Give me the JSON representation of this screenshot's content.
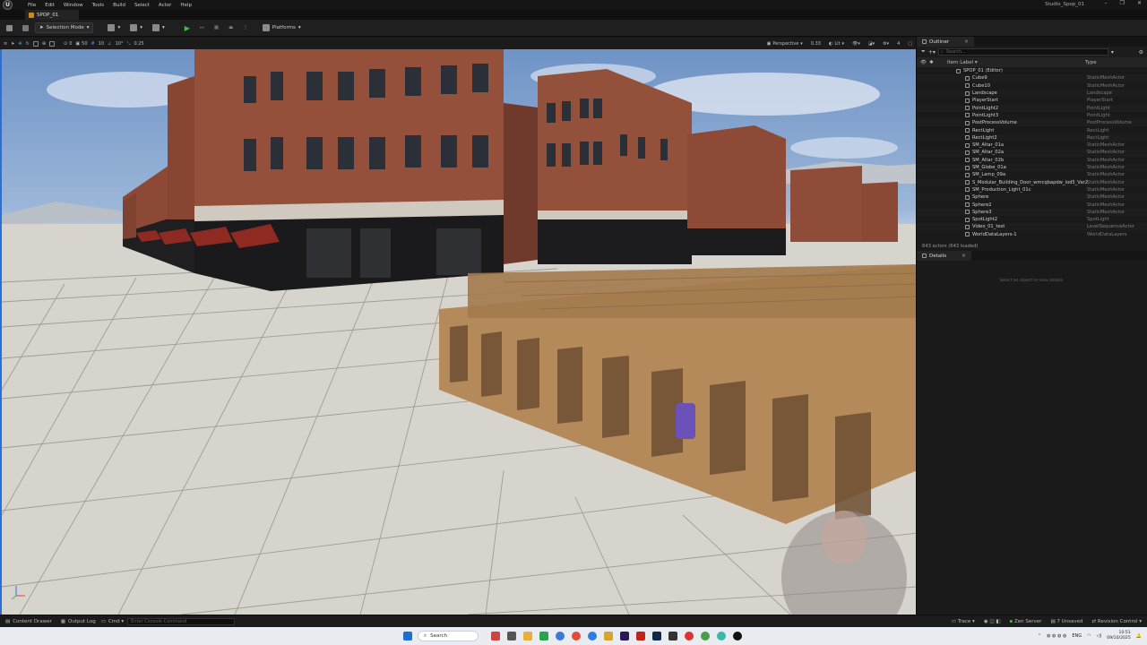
{
  "menu": [
    "File",
    "Edit",
    "Window",
    "Tools",
    "Build",
    "Select",
    "Actor",
    "Help"
  ],
  "window": {
    "project_name": "Studio_Spop_01",
    "minimize": "–",
    "maximize": "❐",
    "close": "✕"
  },
  "level_tab": "SPOP_01",
  "toolbar": {
    "mode": "Selection Mode",
    "platforms": "Platforms"
  },
  "viewport_toolbar": {
    "grid_snap": "10",
    "rot_snap": "10°",
    "scale_snap": "0.25",
    "loc_value": "0",
    "cam_speed": "50",
    "perspective": "Perspective",
    "fov": "0.33",
    "lit": "Lit",
    "right_value": "4"
  },
  "outliner": {
    "tab_label": "Outliner",
    "search_placeholder": "Search...",
    "col_label": "Item Label ▾",
    "col_type": "Type",
    "rows": [
      {
        "name": "SPOP_01 (Editor)",
        "type": "",
        "indent": 0
      },
      {
        "name": "Cube9",
        "type": "StaticMeshActor",
        "indent": 1
      },
      {
        "name": "Cube10",
        "type": "StaticMeshActor",
        "indent": 1
      },
      {
        "name": "Landscape",
        "type": "Landscape",
        "indent": 1
      },
      {
        "name": "PlayerStart",
        "type": "PlayerStart",
        "indent": 1
      },
      {
        "name": "PointLight2",
        "type": "PointLight",
        "indent": 1
      },
      {
        "name": "PointLight3",
        "type": "PointLight",
        "indent": 1
      },
      {
        "name": "PostProcessVolume",
        "type": "PostProcessVolume",
        "indent": 1
      },
      {
        "name": "RectLight",
        "type": "RectLight",
        "indent": 1
      },
      {
        "name": "RectLight2",
        "type": "RectLight",
        "indent": 1
      },
      {
        "name": "SM_Altar_01a",
        "type": "StaticMeshActor",
        "indent": 1
      },
      {
        "name": "SM_Altar_02a",
        "type": "StaticMeshActor",
        "indent": 1
      },
      {
        "name": "SM_Altar_02b",
        "type": "StaticMeshActor",
        "indent": 1
      },
      {
        "name": "SM_Globe_01a",
        "type": "StaticMeshActor",
        "indent": 1
      },
      {
        "name": "SM_Lamp_09a",
        "type": "StaticMeshActor",
        "indent": 1
      },
      {
        "name": "S_Modular_Building_Door_wmcqbapdw_lod5_Var2",
        "type": "StaticMeshActor",
        "indent": 1
      },
      {
        "name": "SM_Production_Light_01c",
        "type": "StaticMeshActor",
        "indent": 1
      },
      {
        "name": "Sphere",
        "type": "StaticMeshActor",
        "indent": 1
      },
      {
        "name": "Sphere2",
        "type": "StaticMeshActor",
        "indent": 1
      },
      {
        "name": "Sphere3",
        "type": "StaticMeshActor",
        "indent": 1
      },
      {
        "name": "SpotLight2",
        "type": "SpotLight",
        "indent": 1
      },
      {
        "name": "Video_01_test",
        "type": "LevelSequenceActor",
        "indent": 1
      },
      {
        "name": "WorldDataLayers-1",
        "type": "WorldDataLayers",
        "indent": 1
      }
    ],
    "actor_count": "643 actors (643 loaded)"
  },
  "details": {
    "tab_label": "Details",
    "empty_message": "Select an object to view details."
  },
  "statusbar": {
    "content_drawer": "Content Drawer",
    "output_log": "Output Log",
    "cmd": "Cmd ▾",
    "console_placeholder": "Enter Console Command",
    "trace": "Trace ▾",
    "zen_server": "Zen Server",
    "unsaved": "7 Unsaved",
    "revision_control": "Revision Control ▾"
  },
  "taskbar": {
    "search": "Search",
    "lang": "ENG",
    "time": "10:51",
    "date": "09/10/2025"
  },
  "colors": {
    "accent": "#2a6fd6",
    "play_green": "#3fbf3f",
    "brick": "#8f4a35"
  }
}
